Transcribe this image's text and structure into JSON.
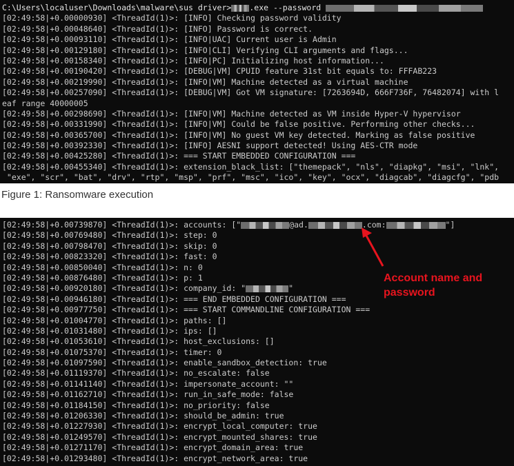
{
  "figure1": {
    "command_prefix": "C:\\Users\\localuser\\Downloads\\malware\\sus driver>",
    "command_mid": ".exe --password",
    "lines": [
      "[02:49:58|+0.00000930] <ThreadId(1)>: [INFO] Checking password validity",
      "[02:49:58|+0.00048640] <ThreadId(1)>: [INFO] Password is correct.",
      "[02:49:58|+0.00093110] <ThreadId(1)>: [INFO|UAC] Current user is Admin",
      "[02:49:58|+0.00129180] <ThreadId(1)>: [INFO|CLI] Verifying CLI arguments and flags...",
      "[02:49:58|+0.00158340] <ThreadId(1)>: [INFO|PC] Initializing host information...",
      "[02:49:58|+0.00190420] <ThreadId(1)>: [DEBUG|VM] CPUID feature 31st bit equals to: FFFAB223",
      "[02:49:58|+0.00219990] <ThreadId(1)>: [INFO|VM] Machine detected as a virtual machine",
      "[02:49:58|+0.00257090] <ThreadId(1)>: [DEBUG|VM] Got VM signature: [7263694D, 666F736F, 76482074] with l",
      "eaf range 40000005",
      "[02:49:58|+0.00298690] <ThreadId(1)>: [INFO|VM] Machine detected as VM inside Hyper-V hypervisor",
      "[02:49:58|+0.00331990] <ThreadId(1)>: [INFO|VM] Could be false positive. Performing other checks...",
      "[02:49:58|+0.00365700] <ThreadId(1)>: [INFO|VM] No guest VM key detected. Marking as false positive",
      "[02:49:58|+0.00392330] <ThreadId(1)>: [INFO] AESNI support detected! Using AES-CTR mode",
      "[02:49:58|+0.00425280] <ThreadId(1)>: === START EMBEDDED CONFIGURATION ===",
      "[02:49:58|+0.00455340] <ThreadId(1)>: extension_black_list: [\"themepack\", \"nls\", \"diapkg\", \"msi\", \"lnk\",",
      " \"exe\", \"scr\", \"bat\", \"drv\", \"rtp\", \"msp\", \"prf\", \"msc\", \"ico\", \"key\", \"ocx\", \"diagcab\", \"diagcfg\", \"pdb"
    ]
  },
  "caption": "Figure 1: Ransomware execution",
  "figure2": {
    "accounts_prefix": "[02:49:58|+0.00739870] <ThreadId(1)>: accounts: [\"",
    "accounts_at": "@ad.",
    "accounts_com": ".com:",
    "accounts_end": "\"]",
    "company_prefix": "[02:49:58|+0.00920180] <ThreadId(1)>: company_id: \"",
    "company_end": "\"",
    "lines_a": [
      "[02:49:58|+0.00769480] <ThreadId(1)>: step: 0",
      "[02:49:58|+0.00798470] <ThreadId(1)>: skip: 0",
      "[02:49:58|+0.00823320] <ThreadId(1)>: fast: 0",
      "[02:49:58|+0.00850040] <ThreadId(1)>: n: 0",
      "[02:49:58|+0.00876480] <ThreadId(1)>: p: 1"
    ],
    "lines_b": [
      "[02:49:58|+0.00946180] <ThreadId(1)>: === END EMBEDDED CONFIGURATION ===",
      "[02:49:58|+0.00977750] <ThreadId(1)>: === START COMMANDLINE CONFIGURATION ===",
      "[02:49:58|+0.01004770] <ThreadId(1)>: paths: []",
      "[02:49:58|+0.01031480] <ThreadId(1)>: ips: []",
      "[02:49:58|+0.01053610] <ThreadId(1)>: host_exclusions: []",
      "[02:49:58|+0.01075370] <ThreadId(1)>: timer: 0",
      "[02:49:58|+0.01097590] <ThreadId(1)>: enable_sandbox_detection: true",
      "[02:49:58|+0.01119370] <ThreadId(1)>: no_escalate: false",
      "[02:49:58|+0.01141140] <ThreadId(1)>: impersonate_account: \"\"",
      "[02:49:58|+0.01162710] <ThreadId(1)>: run_in_safe_mode: false",
      "[02:49:58|+0.01184150] <ThreadId(1)>: no_priority: false",
      "[02:49:58|+0.01206330] <ThreadId(1)>: should_be_admin: true",
      "[02:49:58|+0.01227930] <ThreadId(1)>: encrypt_local_computer: true",
      "[02:49:58|+0.01249570] <ThreadId(1)>: encrypt_mounted_shares: true",
      "[02:49:58|+0.01271170] <ThreadId(1)>: encrypt_domain_area: true",
      "[02:49:58|+0.01293480] <ThreadId(1)>: encrypt_network_area: true"
    ]
  },
  "callout": {
    "line1": "Account name and",
    "line2": "password",
    "color": "#e8141e"
  }
}
